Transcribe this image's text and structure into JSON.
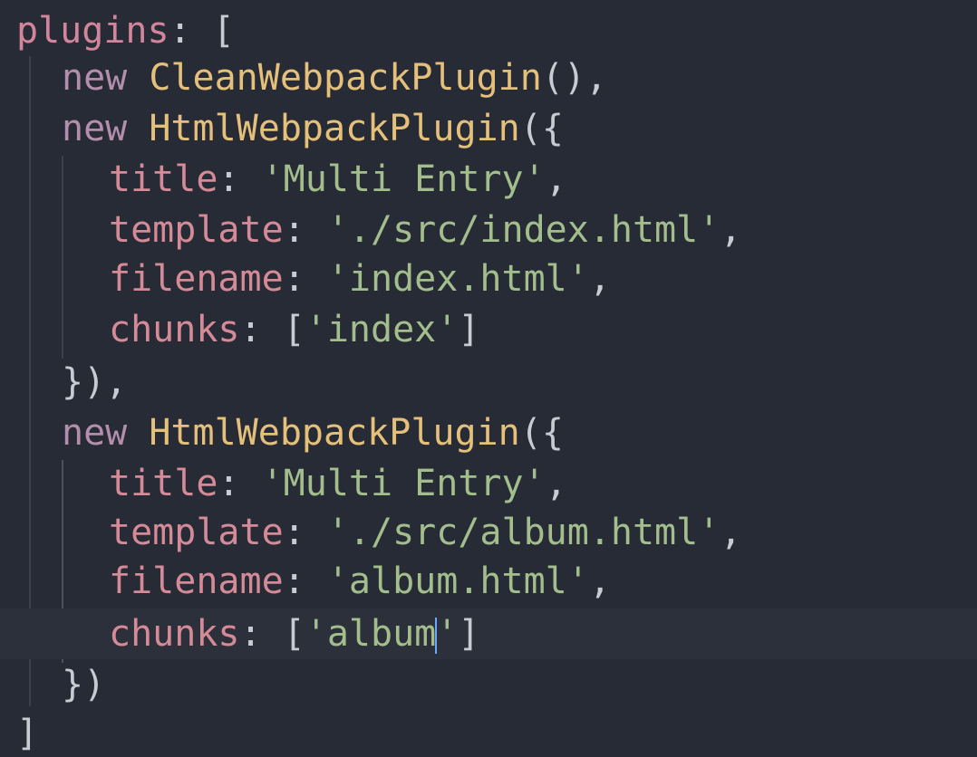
{
  "code": {
    "lines": [
      {
        "indent": 0,
        "tokens": [
          {
            "t": "plugins",
            "c": "tok-key-root"
          },
          {
            "t": ": [",
            "c": "tok-punc"
          }
        ]
      },
      {
        "indent": 1,
        "tokens": [
          {
            "t": "new",
            "c": "tok-kw"
          },
          {
            "t": " ",
            "c": "tok-punc"
          },
          {
            "t": "CleanWebpackPlugin",
            "c": "tok-fn"
          },
          {
            "t": "(),",
            "c": "tok-punc"
          }
        ]
      },
      {
        "indent": 1,
        "tokens": [
          {
            "t": "new",
            "c": "tok-kw"
          },
          {
            "t": " ",
            "c": "tok-punc"
          },
          {
            "t": "HtmlWebpackPlugin",
            "c": "tok-fn"
          },
          {
            "t": "({",
            "c": "tok-punc"
          }
        ]
      },
      {
        "indent": 2,
        "tokens": [
          {
            "t": "title",
            "c": "tok-prop"
          },
          {
            "t": ": ",
            "c": "tok-punc"
          },
          {
            "t": "'Multi Entry'",
            "c": "tok-str"
          },
          {
            "t": ",",
            "c": "tok-punc"
          }
        ]
      },
      {
        "indent": 2,
        "tokens": [
          {
            "t": "template",
            "c": "tok-prop"
          },
          {
            "t": ": ",
            "c": "tok-punc"
          },
          {
            "t": "'./src/index.html'",
            "c": "tok-str"
          },
          {
            "t": ",",
            "c": "tok-punc"
          }
        ]
      },
      {
        "indent": 2,
        "tokens": [
          {
            "t": "filename",
            "c": "tok-prop"
          },
          {
            "t": ": ",
            "c": "tok-punc"
          },
          {
            "t": "'index.html'",
            "c": "tok-str"
          },
          {
            "t": ",",
            "c": "tok-punc"
          }
        ]
      },
      {
        "indent": 2,
        "tokens": [
          {
            "t": "chunks",
            "c": "tok-prop"
          },
          {
            "t": ": [",
            "c": "tok-punc"
          },
          {
            "t": "'index'",
            "c": "tok-str"
          },
          {
            "t": "]",
            "c": "tok-punc"
          }
        ]
      },
      {
        "indent": 1,
        "tokens": [
          {
            "t": "}),",
            "c": "tok-punc"
          }
        ]
      },
      {
        "indent": 1,
        "tokens": [
          {
            "t": "new",
            "c": "tok-kw"
          },
          {
            "t": " ",
            "c": "tok-punc"
          },
          {
            "t": "HtmlWebpackPlugin",
            "c": "tok-fn"
          },
          {
            "t": "({",
            "c": "tok-punc"
          }
        ]
      },
      {
        "indent": 2,
        "tokens": [
          {
            "t": "title",
            "c": "tok-prop"
          },
          {
            "t": ": ",
            "c": "tok-punc"
          },
          {
            "t": "'Multi Entry'",
            "c": "tok-str"
          },
          {
            "t": ",",
            "c": "tok-punc"
          }
        ]
      },
      {
        "indent": 2,
        "tokens": [
          {
            "t": "template",
            "c": "tok-prop"
          },
          {
            "t": ": ",
            "c": "tok-punc"
          },
          {
            "t": "'./src/album.html'",
            "c": "tok-str"
          },
          {
            "t": ",",
            "c": "tok-punc"
          }
        ]
      },
      {
        "indent": 2,
        "tokens": [
          {
            "t": "filename",
            "c": "tok-prop"
          },
          {
            "t": ": ",
            "c": "tok-punc"
          },
          {
            "t": "'album.html'",
            "c": "tok-str"
          },
          {
            "t": ",",
            "c": "tok-punc"
          }
        ]
      },
      {
        "indent": 2,
        "active": true,
        "tokens": [
          {
            "t": "chunks",
            "c": "tok-prop"
          },
          {
            "t": ": [",
            "c": "tok-punc"
          },
          {
            "t": "'album",
            "c": "tok-str"
          },
          {
            "cursor": true
          },
          {
            "t": "'",
            "c": "tok-str"
          },
          {
            "t": "]",
            "c": "tok-punc"
          }
        ]
      },
      {
        "indent": 1,
        "tokens": [
          {
            "t": "})",
            "c": "tok-punc"
          }
        ]
      },
      {
        "indent": 0,
        "tokens": [
          {
            "t": "]",
            "c": "tok-punc"
          }
        ]
      }
    ]
  },
  "colors": {
    "background": "#272b36",
    "keyword": "#b48ead",
    "function": "#e5c07b",
    "property": "#d58a97",
    "string": "#a3be8c",
    "cursor": "#6aa7ff"
  }
}
